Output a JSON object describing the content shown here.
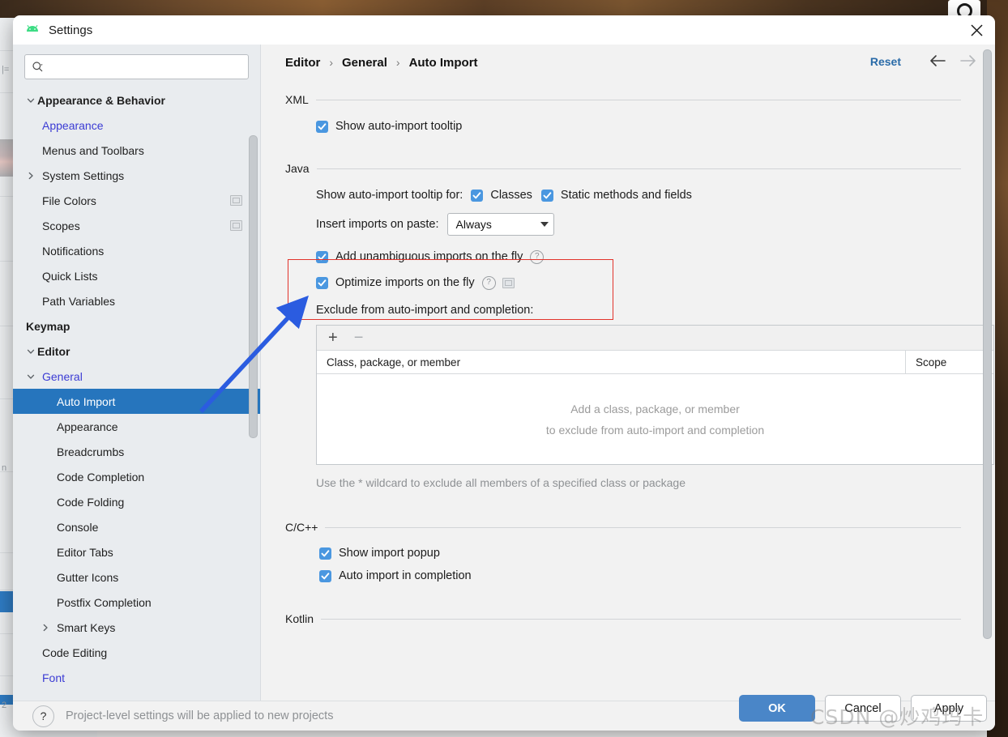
{
  "window": {
    "title": "Settings",
    "app_icon": "android-icon",
    "close_icon": "close-icon"
  },
  "search": {
    "value": "",
    "placeholder": "",
    "icon": "search-icon"
  },
  "sidebar": {
    "items": [
      {
        "label": "Appearance & Behavior",
        "level": 0,
        "expanded": true,
        "arrow": "chevron-down-icon",
        "style": "bold"
      },
      {
        "label": "Appearance",
        "level": 1,
        "style": "link"
      },
      {
        "label": "Menus and Toolbars",
        "level": 1
      },
      {
        "label": "System Settings",
        "level": 1,
        "arrow": "chevron-right-icon"
      },
      {
        "label": "File Colors",
        "level": 1,
        "badge": true
      },
      {
        "label": "Scopes",
        "level": 1,
        "badge": true
      },
      {
        "label": "Notifications",
        "level": 1
      },
      {
        "label": "Quick Lists",
        "level": 1
      },
      {
        "label": "Path Variables",
        "level": 1
      },
      {
        "label": "Keymap",
        "level": 0,
        "style": "bold"
      },
      {
        "label": "Editor",
        "level": 0,
        "expanded": true,
        "arrow": "chevron-down-icon",
        "style": "bold"
      },
      {
        "label": "General",
        "level": 1,
        "expanded": true,
        "arrow": "chevron-down-icon",
        "style": "link"
      },
      {
        "label": "Auto Import",
        "level": 2,
        "selected": true
      },
      {
        "label": "Appearance",
        "level": 2
      },
      {
        "label": "Breadcrumbs",
        "level": 2
      },
      {
        "label": "Code Completion",
        "level": 2
      },
      {
        "label": "Code Folding",
        "level": 2
      },
      {
        "label": "Console",
        "level": 2
      },
      {
        "label": "Editor Tabs",
        "level": 2
      },
      {
        "label": "Gutter Icons",
        "level": 2
      },
      {
        "label": "Postfix Completion",
        "level": 2
      },
      {
        "label": "Smart Keys",
        "level": 2,
        "arrow": "chevron-right-icon"
      },
      {
        "label": "Code Editing",
        "level": 1
      },
      {
        "label": "Font",
        "level": 1,
        "style": "link"
      }
    ]
  },
  "header": {
    "breadcrumb": [
      "Editor",
      "General",
      "Auto Import"
    ],
    "separator": "›",
    "reset_label": "Reset",
    "back_icon": "arrow-left-icon",
    "forward_icon": "arrow-right-icon"
  },
  "sections": {
    "xml": {
      "title": "XML",
      "show_tooltip": {
        "label": "Show auto-import tooltip",
        "checked": true
      }
    },
    "java": {
      "title": "Java",
      "tooltip_for_label": "Show auto-import tooltip for:",
      "tooltip_for_options": [
        {
          "label": "Classes",
          "checked": true
        },
        {
          "label": "Static methods and fields",
          "checked": true
        }
      ],
      "insert_imports_label": "Insert imports on paste:",
      "insert_imports_value": "Always",
      "add_unambiguous": {
        "label": "Add unambiguous imports on the fly",
        "checked": true,
        "help": "?"
      },
      "optimize_imports": {
        "label": "Optimize imports on the fly",
        "checked": true,
        "help": "?",
        "modified_badge": true
      },
      "exclude_label": "Exclude from auto-import and completion:",
      "table": {
        "add_icon": "plus-icon",
        "remove_icon": "minus-icon",
        "columns": [
          "Class, package, or member",
          "Scope"
        ],
        "rows": [],
        "empty_text_line1": "Add a class, package, or member",
        "empty_text_line2": "to exclude from auto-import and completion"
      },
      "hint": "Use the * wildcard to exclude all members of a specified class or package"
    },
    "cpp": {
      "title": "C/C++",
      "options": [
        {
          "label": "Show import popup",
          "checked": true
        },
        {
          "label": "Auto import in completion",
          "checked": true
        }
      ]
    },
    "kotlin": {
      "title": "Kotlin"
    }
  },
  "footer": {
    "help_icon": "question-mark-icon",
    "note": "Project-level settings will be applied to new projects",
    "buttons": [
      {
        "label": "OK",
        "primary": true
      },
      {
        "label": "Cancel",
        "primary": false
      },
      {
        "label": "Apply",
        "primary": false
      }
    ]
  },
  "annotation": {
    "arrow_color": "#2b5ce0",
    "highlight_color": "#e2342c"
  },
  "watermark": "CSDN @炒鸡玛卡",
  "background": {
    "camera_icon": "camera-icon"
  }
}
